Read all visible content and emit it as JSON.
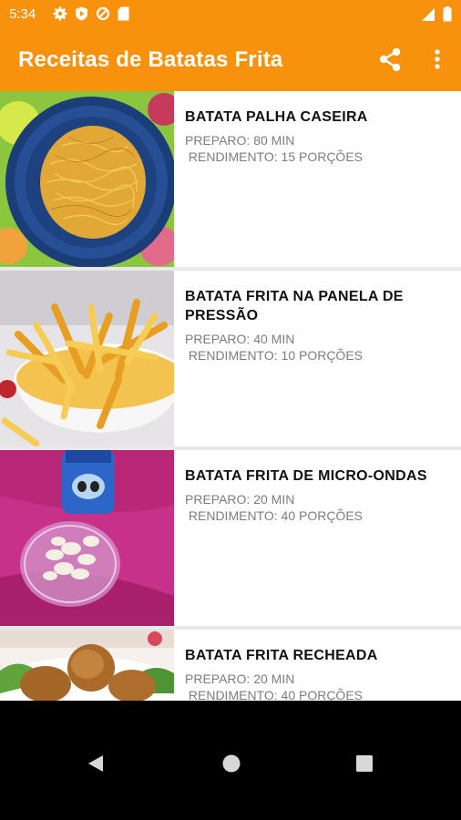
{
  "status_bar": {
    "time": "5:34",
    "left_icons": [
      "gear-icon",
      "play-protect-icon",
      "data-saver-icon",
      "sd-card-icon"
    ],
    "right_icons": [
      "signal-icon",
      "battery-icon"
    ]
  },
  "app_bar": {
    "title": "Receitas de Batatas Frita",
    "background": "#f8910c",
    "actions": [
      "share-icon",
      "more-vert-icon"
    ]
  },
  "recipes": [
    {
      "name": "BATATA PALHA CASEIRA",
      "preparo": "PREPARO: 80 MIN",
      "rendimento": " RENDIMENTO: 15 PORÇÕES"
    },
    {
      "name": "BATATA FRITA NA PANELA DE PRESSÃO",
      "preparo": "PREPARO: 40 MIN",
      "rendimento": " RENDIMENTO: 10 PORÇÕES"
    },
    {
      "name": "BATATA FRITA DE MICRO-ONDAS",
      "preparo": "PREPARO: 20 MIN",
      "rendimento": " RENDIMENTO: 40 PORÇÕES"
    },
    {
      "name": "BATATA FRITA RECHEADA",
      "preparo": "PREPARO: 20 MIN",
      "rendimento": " RENDIMENTO: 40 PORÇÕES"
    }
  ],
  "nav_bar": {
    "buttons": [
      "back-icon",
      "home-icon",
      "recents-icon"
    ]
  }
}
